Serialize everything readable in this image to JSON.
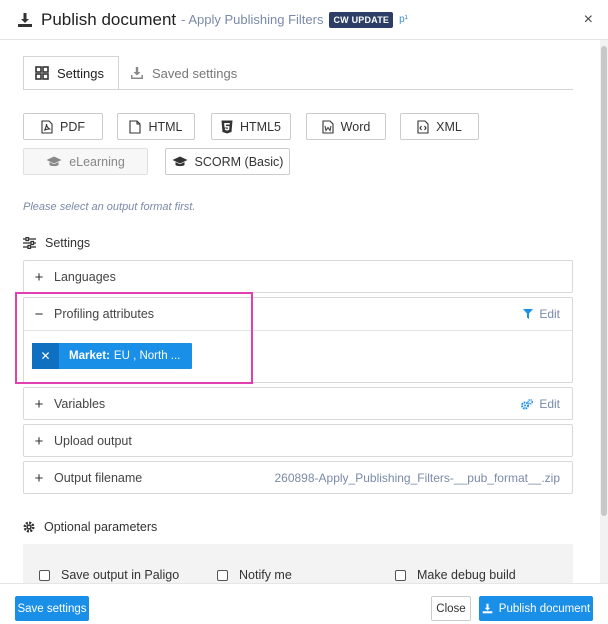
{
  "header": {
    "title": "Publish document",
    "subtitle": "- Apply Publishing Filters",
    "badge": "CW UPDATE",
    "version": "p¹",
    "close": "×"
  },
  "tabs": [
    {
      "label": "Settings",
      "active": true
    },
    {
      "label": "Saved settings",
      "active": false
    }
  ],
  "formats": [
    {
      "label": "PDF",
      "icon": "pdf-icon",
      "disabled": false
    },
    {
      "label": "HTML",
      "icon": "html-file-icon",
      "disabled": false
    },
    {
      "label": "HTML5",
      "icon": "html5-icon",
      "disabled": false
    },
    {
      "label": "Word",
      "icon": "word-icon",
      "disabled": false
    },
    {
      "label": "XML",
      "icon": "xml-icon",
      "disabled": false
    },
    {
      "label": "eLearning",
      "icon": "graduation-cap-icon",
      "disabled": true
    },
    {
      "label": "SCORM (Basic)",
      "icon": "graduation-cap-icon",
      "disabled": false
    }
  ],
  "hint": "Please select an output format first.",
  "settings_title": "Settings",
  "panels": {
    "languages": {
      "label": "Languages"
    },
    "profiling": {
      "label": "Profiling attributes",
      "edit": "Edit",
      "chip": {
        "key": "Market:",
        "value": "EU , North ..."
      }
    },
    "variables": {
      "label": "Variables",
      "edit": "Edit"
    },
    "upload": {
      "label": "Upload output"
    },
    "filename": {
      "label": "Output filename",
      "value": "260898-Apply_Publishing_Filters-__pub_format__.zip"
    }
  },
  "optional_title": "Optional parameters",
  "options": [
    {
      "label": "Save output in Paligo",
      "checked": false
    },
    {
      "label": "Notify me",
      "checked": false
    },
    {
      "label": "Make debug build",
      "checked": false
    }
  ],
  "footer": {
    "save_settings": "Save settings",
    "close": "Close",
    "publish": "Publish document"
  },
  "colors": {
    "accent": "#1a8fe8",
    "badge": "#2c3e66",
    "highlight": "#e040b0",
    "muted_text": "#7a8aa8"
  }
}
